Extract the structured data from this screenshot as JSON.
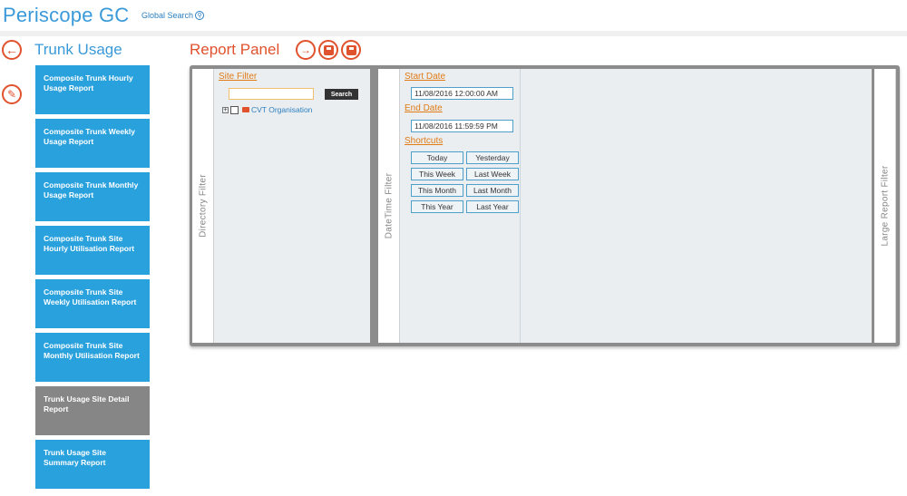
{
  "header": {
    "app_title": "Periscope GC",
    "global_search_label": "Global Search"
  },
  "nav": {
    "section_title": "Trunk Usage",
    "reports": [
      {
        "label": "Composite Trunk Hourly Usage Report",
        "selected": false
      },
      {
        "label": "Composite Trunk Weekly Usage Report",
        "selected": false
      },
      {
        "label": "Composite Trunk Monthly Usage Report",
        "selected": false
      },
      {
        "label": "Composite Trunk Site Hourly Utilisation Report",
        "selected": false
      },
      {
        "label": "Composite Trunk Site Weekly Utilisation Report",
        "selected": false
      },
      {
        "label": "Composite Trunk Site Monthly Utilisation Report",
        "selected": false
      },
      {
        "label": "Trunk Usage Site Detail Report",
        "selected": true
      },
      {
        "label": "Trunk Usage Site Summary Report",
        "selected": false
      }
    ]
  },
  "panel": {
    "title": "Report Panel",
    "directory_filter_tab": "Directory Filter",
    "datetime_filter_tab": "DateTime Filter",
    "large_report_filter_tab": "Large Report Filter",
    "site_filter_label": "Site Filter",
    "search_button": "Search",
    "search_value": "",
    "tree_root_label": "CVT Organisation",
    "start_date_label": "Start Date",
    "start_date_value": "11/08/2016 12:00:00 AM",
    "end_date_label": "End Date",
    "end_date_value": "11/08/2016 11:59:59 PM",
    "shortcuts_label": "Shortcuts",
    "shortcuts": [
      "Today",
      "Yesterday",
      "This Week",
      "Last Week",
      "This Month",
      "Last Month",
      "This Year",
      "Last Year"
    ]
  },
  "colors": {
    "brand_blue": "#3a9ad9",
    "tile_blue": "#29a1dd",
    "tile_selected": "#868686",
    "accent_orange": "#e0512e",
    "link_orange": "#e07b16"
  },
  "icons": {
    "back": "arrow-left-icon",
    "edit": "pencil-icon",
    "run": "arrow-right-icon",
    "save": "save-icon",
    "export": "export-icon",
    "search": "search-icon"
  }
}
